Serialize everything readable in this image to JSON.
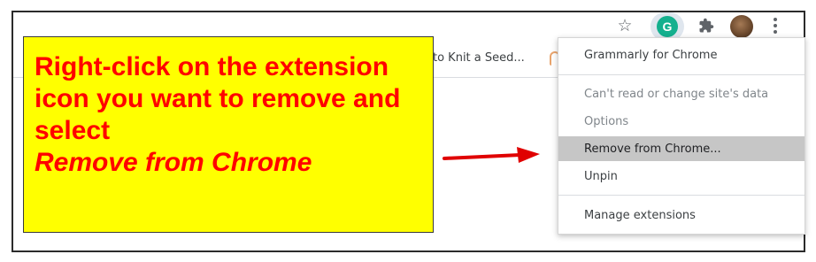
{
  "toolbar": {
    "icons": [
      "star-icon",
      "grammarly-extension-icon",
      "puzzle-icon",
      "profile-avatar",
      "kebab-menu-icon"
    ],
    "grammarly_letter": "G"
  },
  "bookmarks": {
    "item_text": "to Knit a Seed..."
  },
  "callout": {
    "text": "Right-click on the extension icon you want to remove and select",
    "emphasis": "Remove from Chrome",
    "colors": {
      "background": "#ffff00",
      "text": "#ff0000"
    }
  },
  "context_menu": {
    "header": "Grammarly for Chrome",
    "items": [
      {
        "label": "Can't read or change site's data",
        "state": "disabled"
      },
      {
        "label": "Options",
        "state": "disabled"
      },
      {
        "label": "Remove from Chrome...",
        "state": "highlighted"
      },
      {
        "label": "Unpin",
        "state": "normal"
      }
    ],
    "footer": "Manage extensions"
  }
}
